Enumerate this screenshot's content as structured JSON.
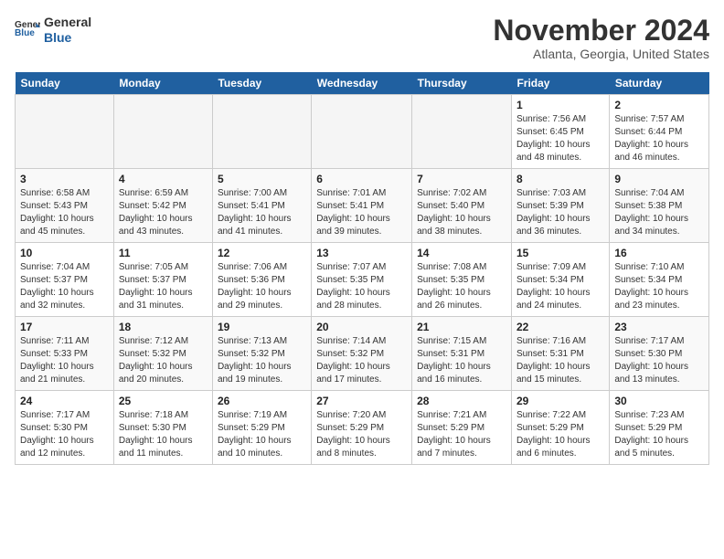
{
  "header": {
    "logo_general": "General",
    "logo_blue": "Blue",
    "title": "November 2024",
    "subtitle": "Atlanta, Georgia, United States"
  },
  "days_of_week": [
    "Sunday",
    "Monday",
    "Tuesday",
    "Wednesday",
    "Thursday",
    "Friday",
    "Saturday"
  ],
  "weeks": [
    [
      {
        "day": "",
        "info": ""
      },
      {
        "day": "",
        "info": ""
      },
      {
        "day": "",
        "info": ""
      },
      {
        "day": "",
        "info": ""
      },
      {
        "day": "",
        "info": ""
      },
      {
        "day": "1",
        "info": "Sunrise: 7:56 AM\nSunset: 6:45 PM\nDaylight: 10 hours and 48 minutes."
      },
      {
        "day": "2",
        "info": "Sunrise: 7:57 AM\nSunset: 6:44 PM\nDaylight: 10 hours and 46 minutes."
      }
    ],
    [
      {
        "day": "3",
        "info": "Sunrise: 6:58 AM\nSunset: 5:43 PM\nDaylight: 10 hours and 45 minutes."
      },
      {
        "day": "4",
        "info": "Sunrise: 6:59 AM\nSunset: 5:42 PM\nDaylight: 10 hours and 43 minutes."
      },
      {
        "day": "5",
        "info": "Sunrise: 7:00 AM\nSunset: 5:41 PM\nDaylight: 10 hours and 41 minutes."
      },
      {
        "day": "6",
        "info": "Sunrise: 7:01 AM\nSunset: 5:41 PM\nDaylight: 10 hours and 39 minutes."
      },
      {
        "day": "7",
        "info": "Sunrise: 7:02 AM\nSunset: 5:40 PM\nDaylight: 10 hours and 38 minutes."
      },
      {
        "day": "8",
        "info": "Sunrise: 7:03 AM\nSunset: 5:39 PM\nDaylight: 10 hours and 36 minutes."
      },
      {
        "day": "9",
        "info": "Sunrise: 7:04 AM\nSunset: 5:38 PM\nDaylight: 10 hours and 34 minutes."
      }
    ],
    [
      {
        "day": "10",
        "info": "Sunrise: 7:04 AM\nSunset: 5:37 PM\nDaylight: 10 hours and 32 minutes."
      },
      {
        "day": "11",
        "info": "Sunrise: 7:05 AM\nSunset: 5:37 PM\nDaylight: 10 hours and 31 minutes."
      },
      {
        "day": "12",
        "info": "Sunrise: 7:06 AM\nSunset: 5:36 PM\nDaylight: 10 hours and 29 minutes."
      },
      {
        "day": "13",
        "info": "Sunrise: 7:07 AM\nSunset: 5:35 PM\nDaylight: 10 hours and 28 minutes."
      },
      {
        "day": "14",
        "info": "Sunrise: 7:08 AM\nSunset: 5:35 PM\nDaylight: 10 hours and 26 minutes."
      },
      {
        "day": "15",
        "info": "Sunrise: 7:09 AM\nSunset: 5:34 PM\nDaylight: 10 hours and 24 minutes."
      },
      {
        "day": "16",
        "info": "Sunrise: 7:10 AM\nSunset: 5:34 PM\nDaylight: 10 hours and 23 minutes."
      }
    ],
    [
      {
        "day": "17",
        "info": "Sunrise: 7:11 AM\nSunset: 5:33 PM\nDaylight: 10 hours and 21 minutes."
      },
      {
        "day": "18",
        "info": "Sunrise: 7:12 AM\nSunset: 5:32 PM\nDaylight: 10 hours and 20 minutes."
      },
      {
        "day": "19",
        "info": "Sunrise: 7:13 AM\nSunset: 5:32 PM\nDaylight: 10 hours and 19 minutes."
      },
      {
        "day": "20",
        "info": "Sunrise: 7:14 AM\nSunset: 5:32 PM\nDaylight: 10 hours and 17 minutes."
      },
      {
        "day": "21",
        "info": "Sunrise: 7:15 AM\nSunset: 5:31 PM\nDaylight: 10 hours and 16 minutes."
      },
      {
        "day": "22",
        "info": "Sunrise: 7:16 AM\nSunset: 5:31 PM\nDaylight: 10 hours and 15 minutes."
      },
      {
        "day": "23",
        "info": "Sunrise: 7:17 AM\nSunset: 5:30 PM\nDaylight: 10 hours and 13 minutes."
      }
    ],
    [
      {
        "day": "24",
        "info": "Sunrise: 7:17 AM\nSunset: 5:30 PM\nDaylight: 10 hours and 12 minutes."
      },
      {
        "day": "25",
        "info": "Sunrise: 7:18 AM\nSunset: 5:30 PM\nDaylight: 10 hours and 11 minutes."
      },
      {
        "day": "26",
        "info": "Sunrise: 7:19 AM\nSunset: 5:29 PM\nDaylight: 10 hours and 10 minutes."
      },
      {
        "day": "27",
        "info": "Sunrise: 7:20 AM\nSunset: 5:29 PM\nDaylight: 10 hours and 8 minutes."
      },
      {
        "day": "28",
        "info": "Sunrise: 7:21 AM\nSunset: 5:29 PM\nDaylight: 10 hours and 7 minutes."
      },
      {
        "day": "29",
        "info": "Sunrise: 7:22 AM\nSunset: 5:29 PM\nDaylight: 10 hours and 6 minutes."
      },
      {
        "day": "30",
        "info": "Sunrise: 7:23 AM\nSunset: 5:29 PM\nDaylight: 10 hours and 5 minutes."
      }
    ]
  ]
}
